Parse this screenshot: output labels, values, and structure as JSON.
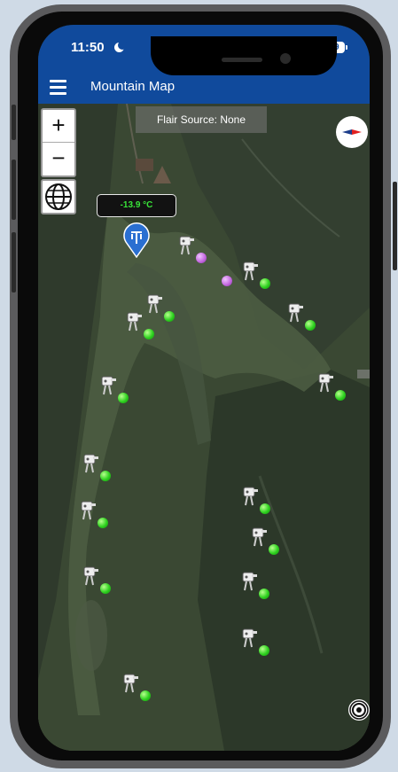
{
  "status_bar": {
    "time": "11:50",
    "battery": "89"
  },
  "header": {
    "title": "Mountain Map"
  },
  "map_controls": {
    "zoom_in_label": "+",
    "zoom_out_label": "−",
    "flair_source": "Flair Source:  None"
  },
  "weather_station": {
    "temperature": "-13.9 °C"
  },
  "snow_guns": [
    {
      "status": "purple"
    },
    {
      "status": "green"
    },
    {
      "status": "green"
    },
    {
      "status": "green"
    },
    {
      "status": "green"
    },
    {
      "status": "green"
    },
    {
      "status": "green"
    },
    {
      "status": "green"
    },
    {
      "status": "green"
    },
    {
      "status": "green"
    },
    {
      "status": "green"
    },
    {
      "status": "green"
    },
    {
      "status": "green"
    },
    {
      "status": "green"
    },
    {
      "status": "green"
    },
    {
      "status": "green"
    },
    {
      "status": "purple"
    }
  ],
  "colors": {
    "header_blue": "#104a9c",
    "temperature_green": "#39e339",
    "status_green": "#2ed11f",
    "status_purple": "#c56ae0",
    "pin_blue": "#2a6fd1"
  }
}
